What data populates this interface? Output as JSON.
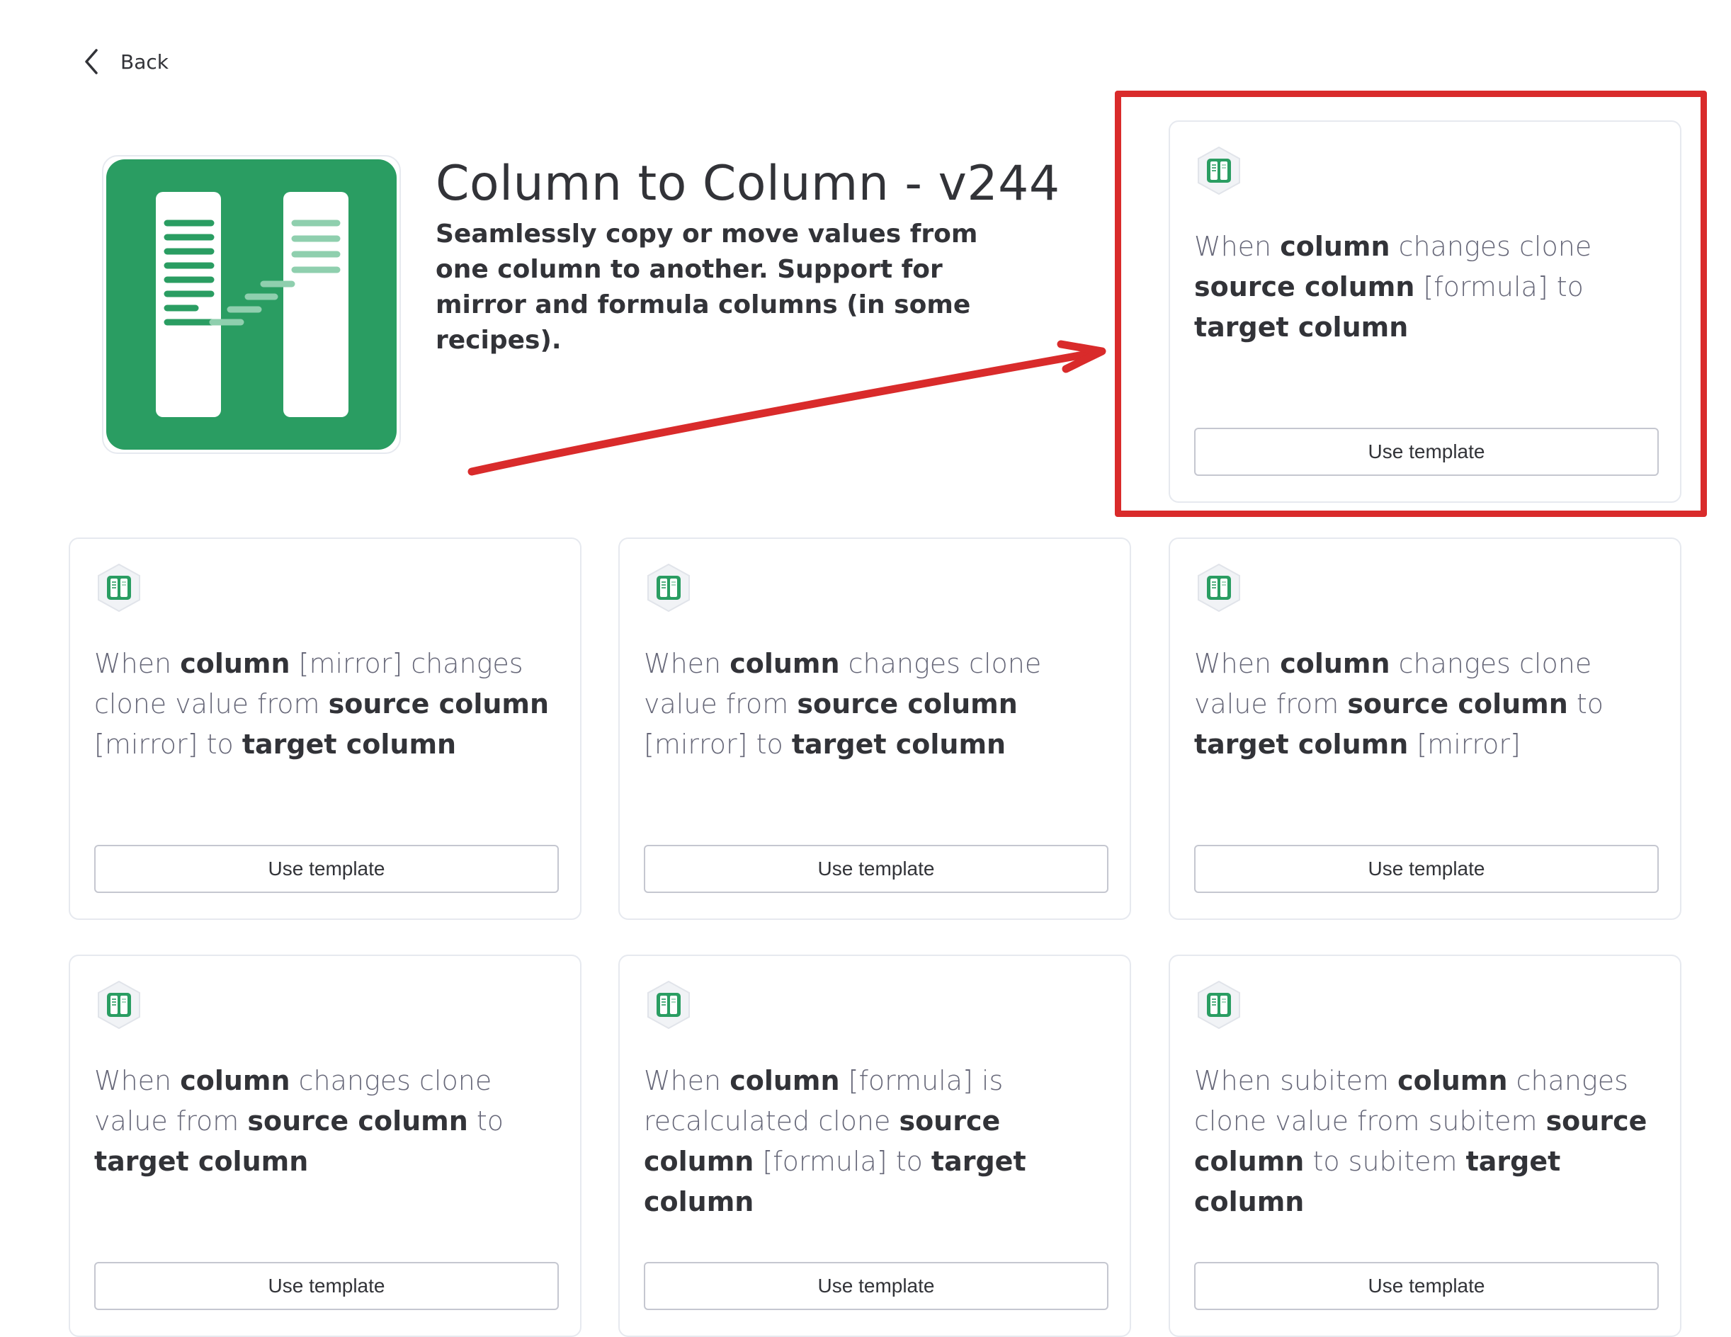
{
  "back": {
    "label": "Back"
  },
  "app": {
    "title": "Column to Column - v244",
    "description": "Seamlessly copy or move values from one column to another. Support for mirror and formula columns (in some recipes)."
  },
  "colors": {
    "brand_green": "#2a9d62",
    "annotation_red": "#d92b2b"
  },
  "icons": {
    "back": "chevron-left-icon",
    "app": "column-to-column-icon"
  },
  "templates": [
    {
      "button": "Use template",
      "recipe": [
        {
          "t": "When ",
          "b": false
        },
        {
          "t": "column",
          "b": true
        },
        {
          "t": " changes clone ",
          "b": false
        },
        {
          "t": "source column",
          "b": true
        },
        {
          "t": " [formula] to ",
          "b": false
        },
        {
          "t": "target column",
          "b": true
        }
      ]
    },
    {
      "button": "Use template",
      "recipe": [
        {
          "t": "When ",
          "b": false
        },
        {
          "t": "column",
          "b": true
        },
        {
          "t": " [mirror] changes clone value from ",
          "b": false
        },
        {
          "t": "source column",
          "b": true
        },
        {
          "t": " [mirror] to ",
          "b": false
        },
        {
          "t": "target column",
          "b": true
        }
      ]
    },
    {
      "button": "Use template",
      "recipe": [
        {
          "t": "When ",
          "b": false
        },
        {
          "t": "column",
          "b": true
        },
        {
          "t": " changes clone value from ",
          "b": false
        },
        {
          "t": "source column",
          "b": true
        },
        {
          "t": " [mirror] to ",
          "b": false
        },
        {
          "t": "target column",
          "b": true
        }
      ]
    },
    {
      "button": "Use template",
      "recipe": [
        {
          "t": "When ",
          "b": false
        },
        {
          "t": "column",
          "b": true
        },
        {
          "t": " changes clone value from ",
          "b": false
        },
        {
          "t": "source column",
          "b": true
        },
        {
          "t": " to ",
          "b": false
        },
        {
          "t": "target column",
          "b": true
        },
        {
          "t": " [mirror]",
          "b": false
        }
      ]
    },
    {
      "button": "Use template",
      "recipe": [
        {
          "t": "When ",
          "b": false
        },
        {
          "t": "column",
          "b": true
        },
        {
          "t": " changes clone value from ",
          "b": false
        },
        {
          "t": "source column",
          "b": true
        },
        {
          "t": " to ",
          "b": false
        },
        {
          "t": "target column",
          "b": true
        }
      ]
    },
    {
      "button": "Use template",
      "recipe": [
        {
          "t": "When ",
          "b": false
        },
        {
          "t": "column",
          "b": true
        },
        {
          "t": " [formula] is recalculated clone ",
          "b": false
        },
        {
          "t": "source column",
          "b": true
        },
        {
          "t": " [formula] to ",
          "b": false
        },
        {
          "t": "target column",
          "b": true
        }
      ]
    },
    {
      "button": "Use template",
      "recipe": [
        {
          "t": "When subitem ",
          "b": false
        },
        {
          "t": "column",
          "b": true
        },
        {
          "t": " changes clone value from subitem ",
          "b": false
        },
        {
          "t": "source column",
          "b": true
        },
        {
          "t": " to subitem ",
          "b": false
        },
        {
          "t": "target column",
          "b": true
        }
      ]
    }
  ]
}
